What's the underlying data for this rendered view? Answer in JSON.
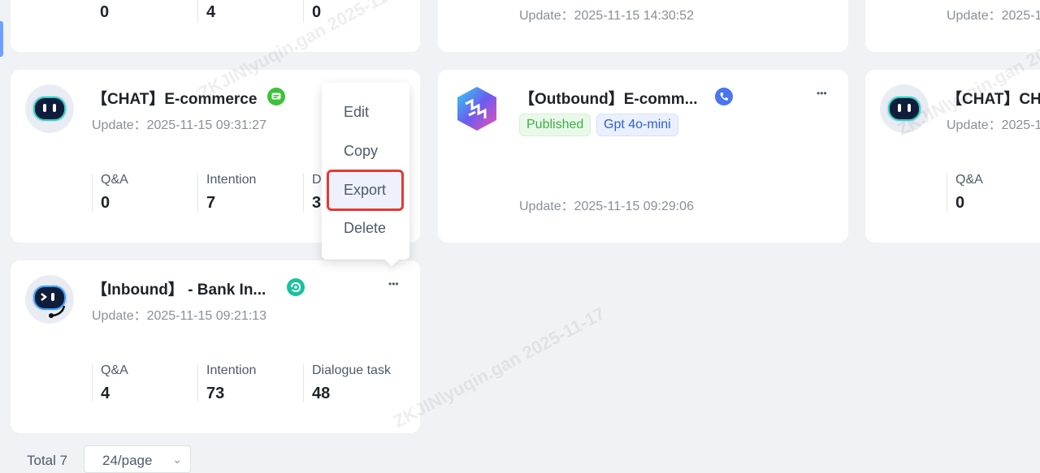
{
  "top_row": {
    "card1_values": [
      "0",
      "4",
      "0"
    ],
    "card2_update": "Update：2025-11-15 14:30:52",
    "card3_update": "Update：2025-1"
  },
  "cards": {
    "chat_ecom": {
      "title": "【CHAT】E-commerce",
      "update": "Update：2025-11-15 09:31:27",
      "stats": [
        {
          "label": "Q&A",
          "value": "0"
        },
        {
          "label": "Intention",
          "value": "7"
        },
        {
          "label": "D",
          "value": "3"
        }
      ],
      "badge_color": "#3cc13b"
    },
    "outbound": {
      "title": "【Outbound】E-comm...",
      "tags": [
        "Published",
        "Gpt 4o-mini"
      ],
      "update": "Update：2025-11-15 09:29:06",
      "badge_color": "#4a74f0"
    },
    "chat_right": {
      "title": "【CHAT】CH",
      "update": "Update：2025-1",
      "stats": [
        {
          "label": "Q&A",
          "value": "0"
        }
      ]
    },
    "inbound": {
      "title": "【Inbound】 - Bank In...",
      "update": "Update：2025-11-15 09:21:13",
      "stats": [
        {
          "label": "Q&A",
          "value": "4"
        },
        {
          "label": "Intention",
          "value": "73"
        },
        {
          "label": "Dialogue task",
          "value": "48"
        }
      ],
      "badge_color": "#18c0a0"
    }
  },
  "context_menu": {
    "items": [
      "Edit",
      "Copy",
      "Export",
      "Delete"
    ],
    "highlighted": "Export"
  },
  "pagination": {
    "total": "Total 7",
    "page_size": "24/page"
  },
  "watermark": "ZKJIN\\yuqin.gan  2025-11-17",
  "more_glyph": "•••"
}
